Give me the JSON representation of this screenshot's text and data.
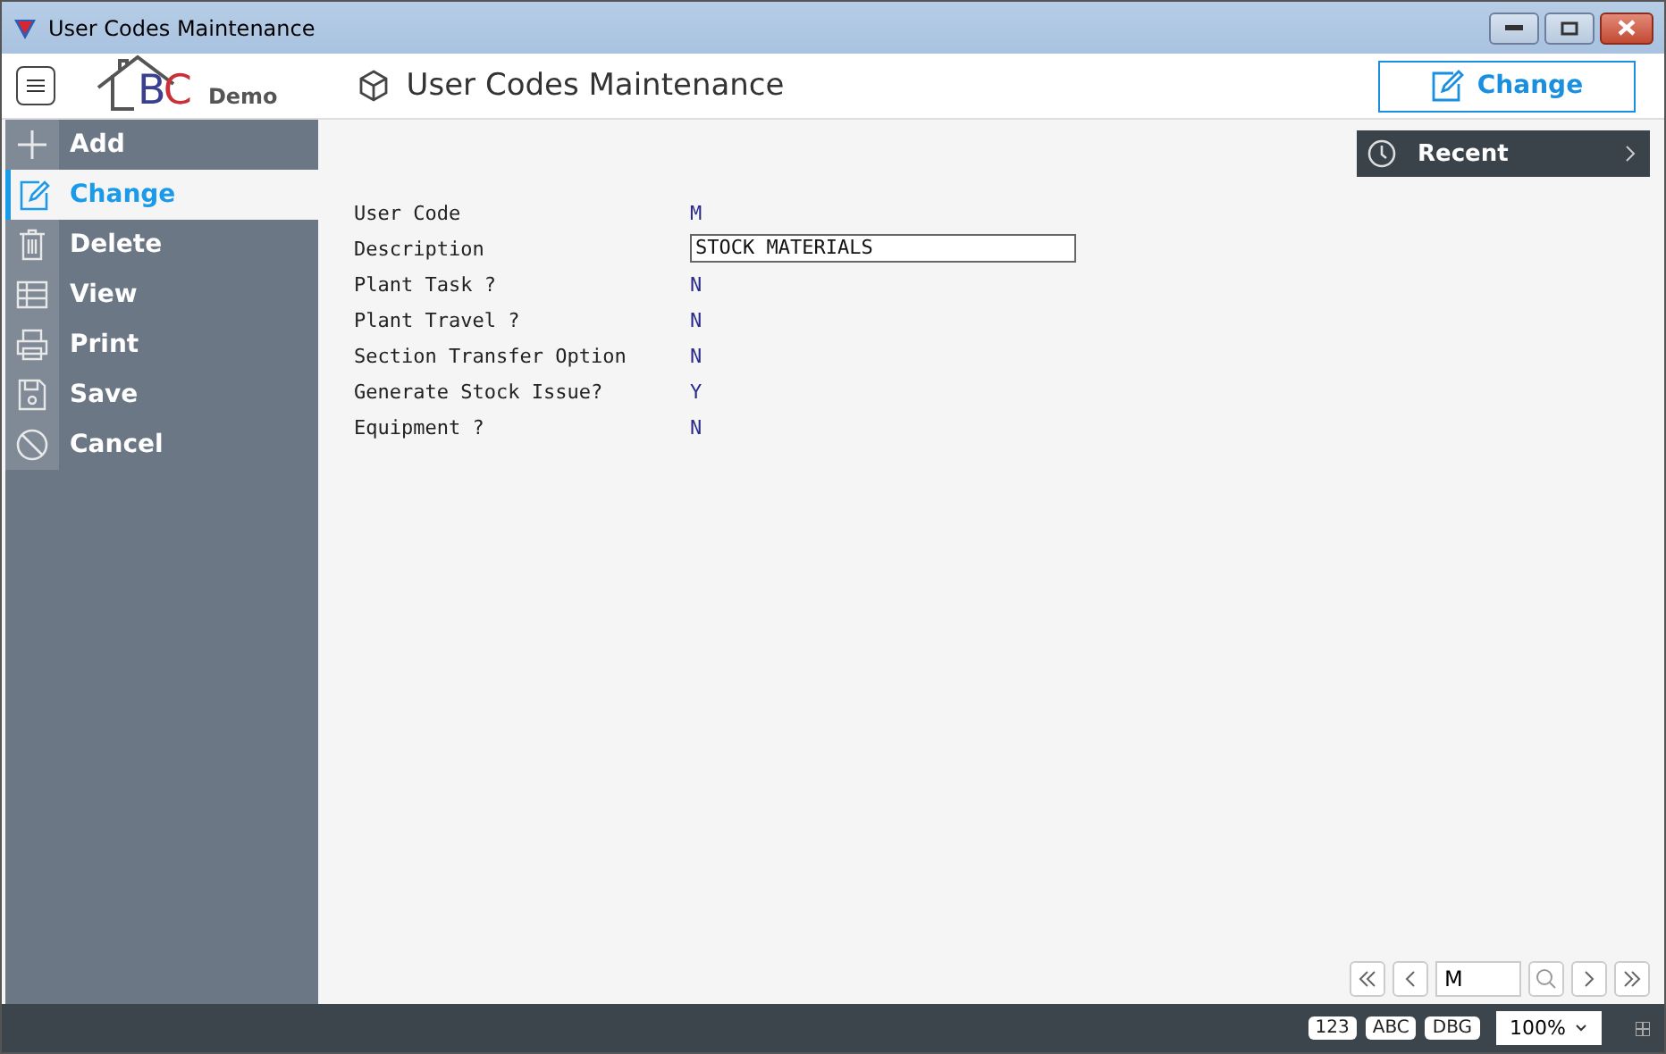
{
  "window": {
    "title": "User Codes Maintenance"
  },
  "header": {
    "logo_b": "B",
    "logo_c": "C",
    "logo_suffix": "Demo",
    "title": "User Codes Maintenance",
    "action": "Change"
  },
  "sidebar": {
    "items": [
      {
        "label": "Add",
        "kind": "add",
        "selected": false
      },
      {
        "label": "Change",
        "kind": "change",
        "selected": true
      },
      {
        "label": "Delete",
        "kind": "delete",
        "selected": false
      },
      {
        "label": "View",
        "kind": "view",
        "selected": false
      },
      {
        "label": "Print",
        "kind": "print",
        "selected": false
      },
      {
        "label": "Save",
        "kind": "save",
        "selected": false
      },
      {
        "label": "Cancel",
        "kind": "cancel",
        "selected": false
      }
    ]
  },
  "recent": {
    "label": "Recent"
  },
  "form": {
    "fields": [
      {
        "label": "User Code",
        "value": "M",
        "kind": "text"
      },
      {
        "label": "Description",
        "value": "STOCK MATERIALS",
        "kind": "input"
      },
      {
        "label": "Plant Task ?",
        "value": "N",
        "kind": "text"
      },
      {
        "label": "Plant Travel ?",
        "value": "N",
        "kind": "text"
      },
      {
        "label": "Section Transfer Option",
        "value": "N",
        "kind": "text"
      },
      {
        "label": "Generate Stock Issue?",
        "value": "Y",
        "kind": "text"
      },
      {
        "label": "Equipment ?",
        "value": "N",
        "kind": "text"
      }
    ]
  },
  "navigator": {
    "value": "M"
  },
  "status_bar": {
    "badges": [
      "123",
      "ABC",
      "DBG"
    ],
    "zoom": "100%"
  }
}
